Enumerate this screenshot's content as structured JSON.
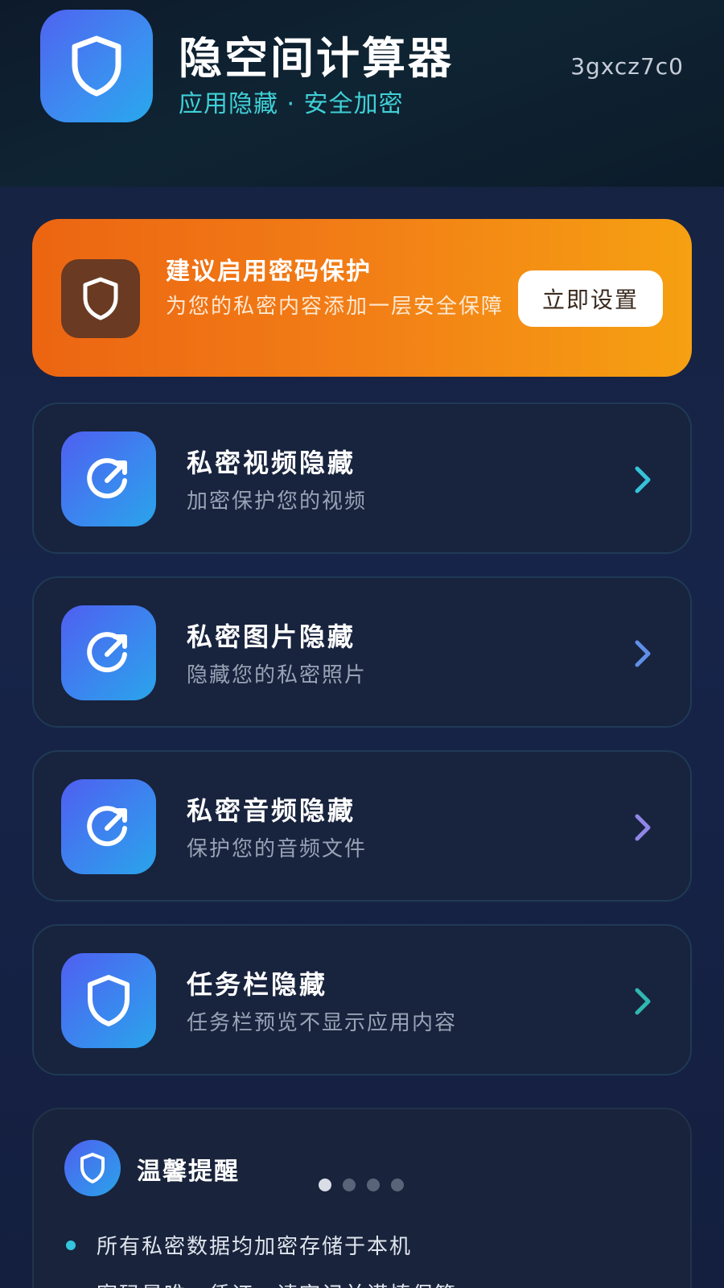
{
  "app": {
    "title": "隐空间计算器",
    "subtitle": "应用隐藏 · 安全加密",
    "device_id": "3gxcz7c0",
    "icon": "shield-icon"
  },
  "banner": {
    "title": "建议启用密码保护",
    "description": "为您的私密内容添加一层安全保障",
    "button_label": "立即设置",
    "icon": "shield-icon",
    "gradient": [
      "#ec6512",
      "#f6a012"
    ]
  },
  "features": [
    {
      "title": "私密视频隐藏",
      "subtitle": "加密保护您的视频",
      "icon": "arrow-circle-icon",
      "chevron_color": "#35c3d9"
    },
    {
      "title": "私密图片隐藏",
      "subtitle": "隐藏您的私密照片",
      "icon": "arrow-circle-icon",
      "chevron_color": "#5f8fe6"
    },
    {
      "title": "私密音频隐藏",
      "subtitle": "保护您的音频文件",
      "icon": "arrow-circle-icon",
      "chevron_color": "#8f86e6"
    },
    {
      "title": "任务栏隐藏",
      "subtitle": "任务栏预览不显示应用内容",
      "icon": "shield-icon",
      "chevron_color": "#2fb8b0"
    }
  ],
  "tips": {
    "title": "温馨提醒",
    "icon": "shield-icon",
    "carousel": {
      "count": 4,
      "active": 0
    },
    "items": [
      {
        "text": "所有私密数据均加密存储于本机",
        "bullet_color": "#33c6dc"
      },
      {
        "text": "密码是唯一凭证，请牢记并谨慎保管",
        "bullet_color": "#5f8fe6"
      }
    ]
  },
  "colors": {
    "accent_teal": "#3fd0d6",
    "card_border": "#1f3a55",
    "icon_gradient": [
      "#4f5ff0",
      "#2aa4ea"
    ]
  }
}
